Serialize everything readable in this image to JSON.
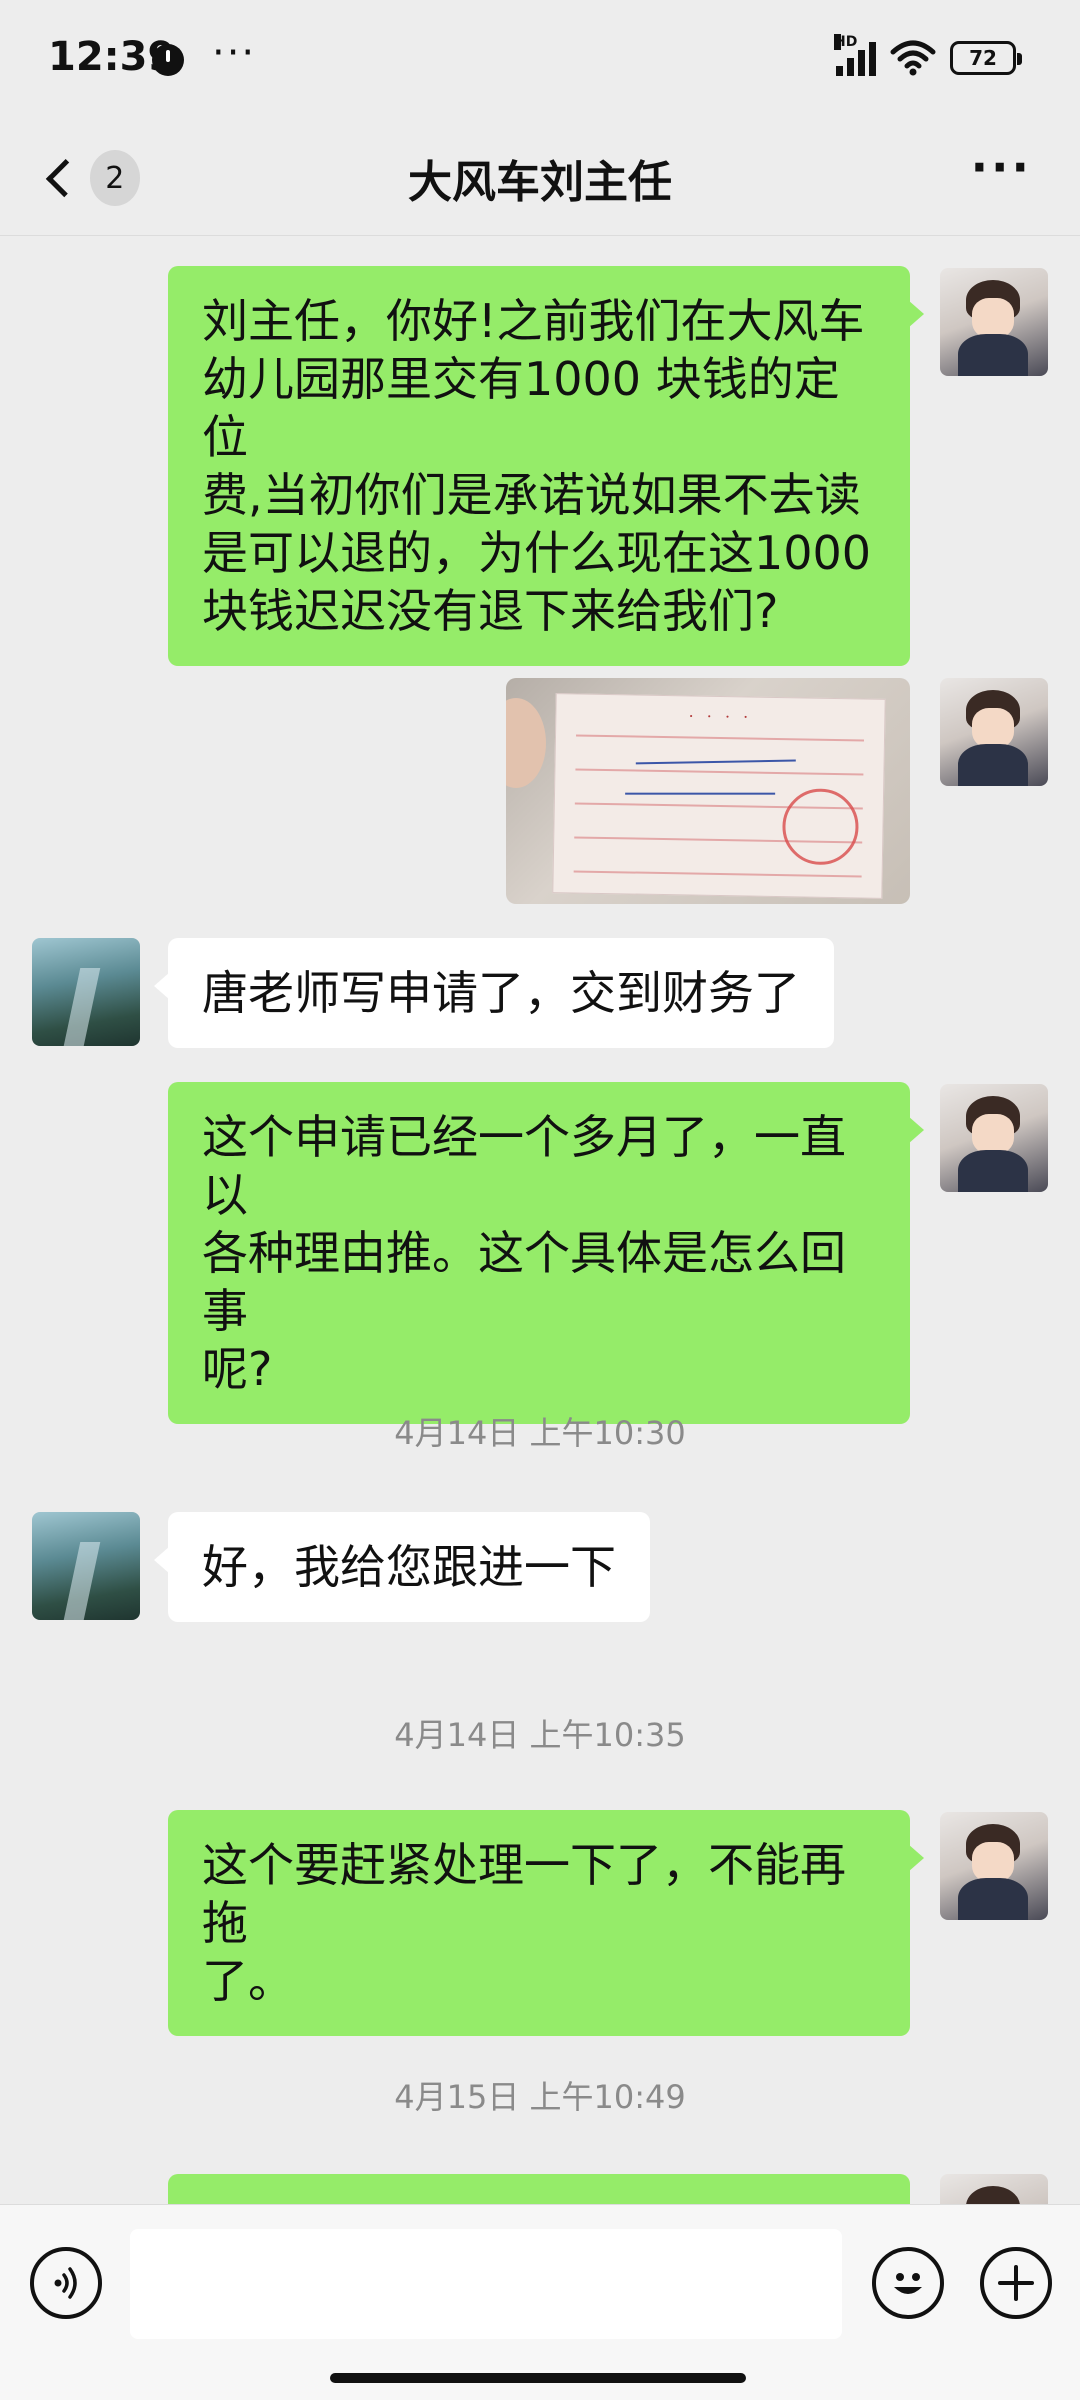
{
  "status_bar": {
    "time": "12:39",
    "more": "···",
    "network": "HD",
    "battery": "72",
    "icons": [
      "do-not-disturb-icon",
      "signal-icon",
      "wifi-icon",
      "battery-icon"
    ]
  },
  "header": {
    "back_count": "2",
    "title": "大风车刘主任",
    "more": "···"
  },
  "messages": [
    {
      "sender": "me",
      "text": "刘主任，你好!之前我们在大风车幼儿园那里交有1000 块钱的定位费,当初你们是承诺说如果不去读是可以退的，为什么现在这1000块钱迟迟没有退下来给我们?"
    },
    {
      "sender": "me",
      "type": "image",
      "description_icon": "receipt-photo"
    },
    {
      "sender": "other",
      "text": "唐老师写申请了，交到财务了"
    },
    {
      "sender": "me",
      "text": "这个申请已经一个多月了，一直以各种理由推。这个具体是怎么回事呢?"
    },
    {
      "type": "timestamp",
      "text": "4月14日 上午10:30"
    },
    {
      "sender": "other",
      "text": "好，我给您跟进一下"
    },
    {
      "type": "timestamp",
      "text": "4月14日 上午10:35"
    },
    {
      "sender": "me",
      "text": "这个要赶紧处理一下了，不能再拖了。"
    },
    {
      "type": "timestamp",
      "text": "4月15日 上午10:49"
    }
  ],
  "message_lines": {
    "m1": [
      "刘主任，你好!之前我们在大风车",
      "幼儿园那里交有1000 块钱的定位",
      "费,当初你们是承诺说如果不去读",
      "是可以退的，为什么现在这1000",
      "块钱迟迟没有退下来给我们?"
    ],
    "m4": [
      "这个申请已经一个多月了，一直以",
      "各种理由推。这个具体是怎么回事",
      "呢?"
    ],
    "m6": [
      "这个要赶紧处理一下了，不能再拖",
      "了。"
    ]
  },
  "input_bar": {
    "placeholder": "",
    "icons": [
      "voice-icon",
      "emoji-icon",
      "plus-icon"
    ]
  },
  "colors": {
    "background": "#ededed",
    "bubble_me": "#95ec69",
    "bubble_other": "#ffffff",
    "timestamp": "#8a8a8a"
  }
}
